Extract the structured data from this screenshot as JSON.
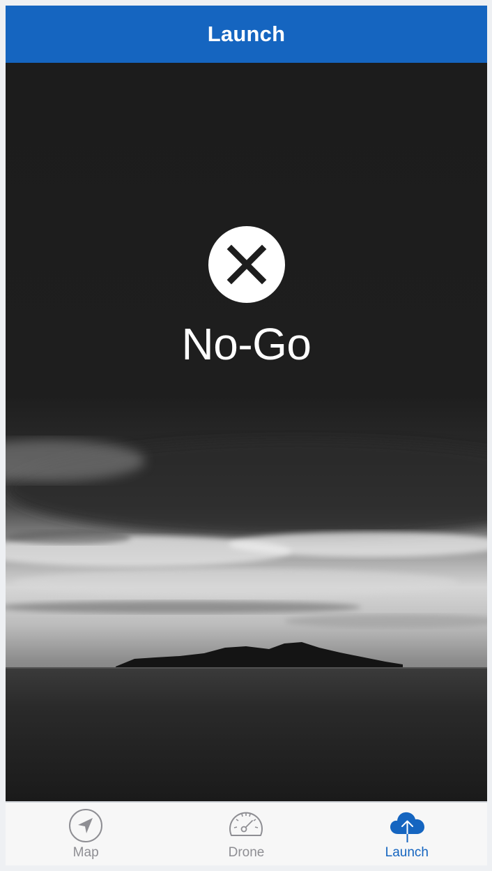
{
  "navbar": {
    "title": "Launch"
  },
  "status": {
    "label": "No-Go",
    "icon": "close-icon",
    "icon_color": "#1d1d1d"
  },
  "tabs": [
    {
      "label": "Map",
      "icon": "location-arrow-icon",
      "active": false
    },
    {
      "label": "Drone",
      "icon": "speedometer-icon",
      "active": false
    },
    {
      "label": "Launch",
      "icon": "cloud-upload-icon",
      "active": true
    }
  ],
  "colors": {
    "accent": "#1565c0",
    "tab_inactive": "#8e8e93",
    "tabbar_bg": "#f7f7f7"
  }
}
